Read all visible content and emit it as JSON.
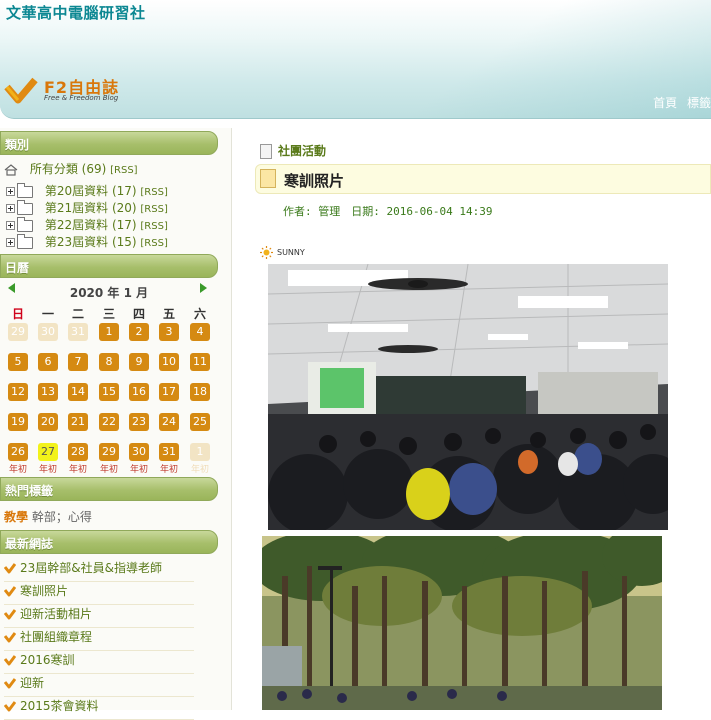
{
  "header": {
    "site_title": "文華高中電腦研習社",
    "logo_name": "F2自由誌",
    "logo_sub": "Free & Freedom Blog",
    "nav": [
      "首頁",
      "標籤"
    ]
  },
  "sidebar": {
    "categories": {
      "heading": "類別",
      "all": {
        "label": "所有分類",
        "count": "(69)",
        "rss": "[RSS]"
      },
      "items": [
        {
          "label": "第20屆資料",
          "count": "(17)",
          "rss": "[RSS]"
        },
        {
          "label": "第21屆資料",
          "count": "(20)",
          "rss": "[RSS]"
        },
        {
          "label": "第22屆資料",
          "count": "(17)",
          "rss": "[RSS]"
        },
        {
          "label": "第23屆資料",
          "count": "(15)",
          "rss": "[RSS]"
        }
      ]
    },
    "calendar": {
      "heading": "日曆",
      "title": "2020 年 1 月",
      "weekdays": [
        "日",
        "一",
        "二",
        "三",
        "四",
        "五",
        "六"
      ],
      "today": "27",
      "days": [
        [
          "29",
          "30",
          "31",
          "1",
          "2",
          "3",
          "4"
        ],
        [
          "5",
          "6",
          "7",
          "8",
          "9",
          "10",
          "11"
        ],
        [
          "12",
          "13",
          "14",
          "15",
          "16",
          "17",
          "18"
        ],
        [
          "19",
          "20",
          "21",
          "22",
          "23",
          "24",
          "25"
        ],
        [
          "26",
          "27",
          "28",
          "29",
          "30",
          "31",
          "1"
        ]
      ],
      "holiday_note": "年初"
    },
    "tags": {
      "heading": "熱門標籤",
      "hot": "教學",
      "rest": "幹部；心得"
    },
    "recent": {
      "heading": "最新網誌",
      "items": [
        "23屆幹部&社員&指導老師",
        "寒訓照片",
        "迎新活動相片",
        "社團組織章程",
        "2016寒訓",
        "迎新",
        "2015茶會資料"
      ]
    }
  },
  "main": {
    "category": "社團活動",
    "post_title": "寒訓照片",
    "meta": "作者: 管理　日期: 2016-06-04 14:39",
    "mood": "SUNNY"
  },
  "colors": {
    "accent_green": "#9ab55a",
    "calendar_orange": "#d58a12",
    "today_yellow": "#f2f21a",
    "title_teal": "#0b8792"
  }
}
